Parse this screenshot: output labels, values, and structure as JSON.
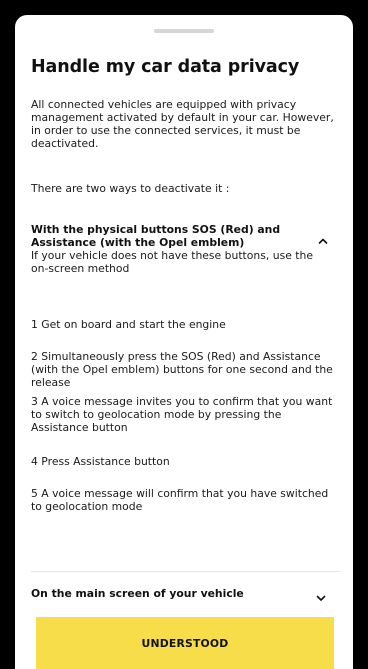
{
  "sheet": {
    "title": "Handle my car data privacy",
    "intro": "All connected vehicles are equipped with privacy management activated by default in your car. However, in order to use the connected services, it must be deactivated.",
    "ways": "There are two ways to deactivate it :"
  },
  "accordion_physical": {
    "title": "With the physical buttons SOS (Red) and Assistance (with the Opel emblem)",
    "subtitle": "If your vehicle does not have these buttons, use the on-screen method",
    "expanded": true,
    "steps": [
      "1 Get on board and start the engine",
      "2 Simultaneously press the SOS (Red) and Assistance (with the Opel emblem) buttons for one second and the release",
      "3 A voice message invites you to confirm that you want to switch to geolocation mode by pressing the Assistance button",
      "4 Press Assistance button",
      "5 A voice message will confirm that you have switched to geolocation mode"
    ]
  },
  "accordion_screen": {
    "title": "On the main screen of your vehicle",
    "expanded": false
  },
  "button": {
    "label": "UNDERSTOOD"
  },
  "colors": {
    "accent": "#f7dd4a",
    "background": "#000000",
    "sheet": "#ffffff"
  },
  "icons": {
    "collapse": "chevron-up-icon",
    "expand": "chevron-down-icon"
  }
}
